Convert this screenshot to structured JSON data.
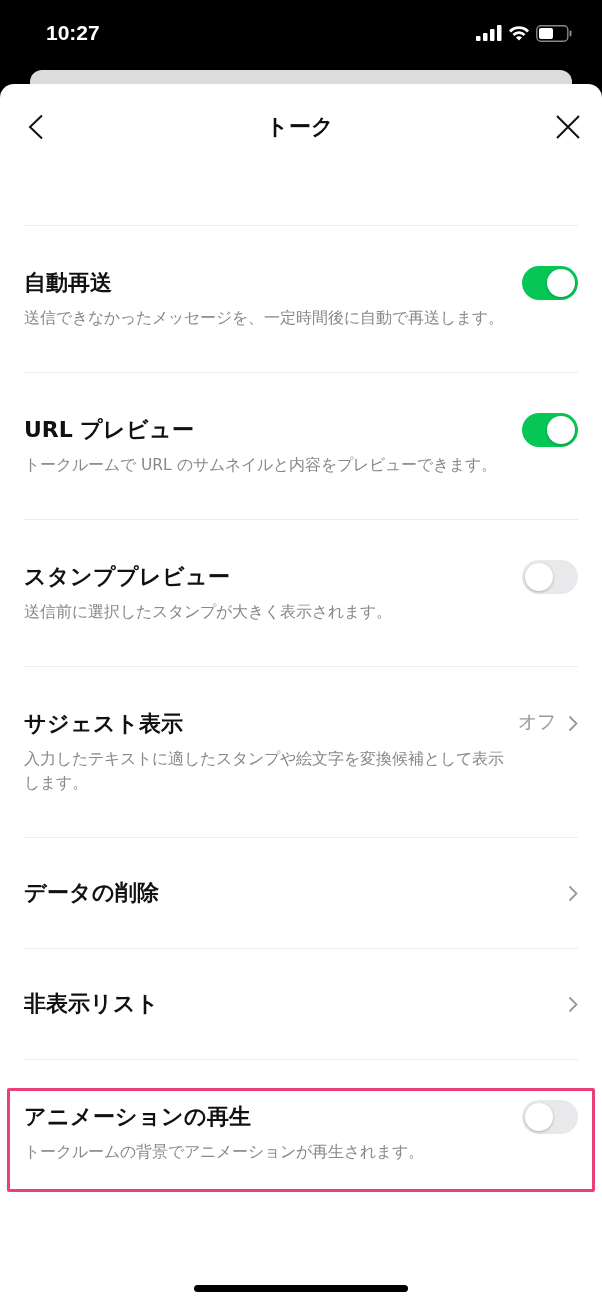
{
  "status_bar": {
    "time": "10:27"
  },
  "header": {
    "title": "トーク"
  },
  "settings": [
    {
      "kind": "toggle",
      "title": "自動再送",
      "description": "送信できなかったメッセージを、一定時間後に自動で再送します。",
      "on": true,
      "highlighted": false
    },
    {
      "kind": "toggle",
      "title": "URL プレビュー",
      "description": "トークルームで URL のサムネイルと内容をプレビューできます。",
      "on": true,
      "highlighted": false
    },
    {
      "kind": "toggle",
      "title": "スタンププレビュー",
      "description": "送信前に選択したスタンプが大きく表示されます。",
      "on": false,
      "highlighted": false
    },
    {
      "kind": "link",
      "title": "サジェスト表示",
      "value": "オフ",
      "description": "入力したテキストに適したスタンプや絵文字を変換候補として表示します。",
      "highlighted": false
    },
    {
      "kind": "link",
      "title": "データの削除",
      "highlighted": false
    },
    {
      "kind": "link",
      "title": "非表示リスト",
      "highlighted": false
    },
    {
      "kind": "toggle",
      "title": "アニメーションの再生",
      "description": "トークルームの背景でアニメーションが再生されます。",
      "on": false,
      "highlighted": true
    }
  ]
}
